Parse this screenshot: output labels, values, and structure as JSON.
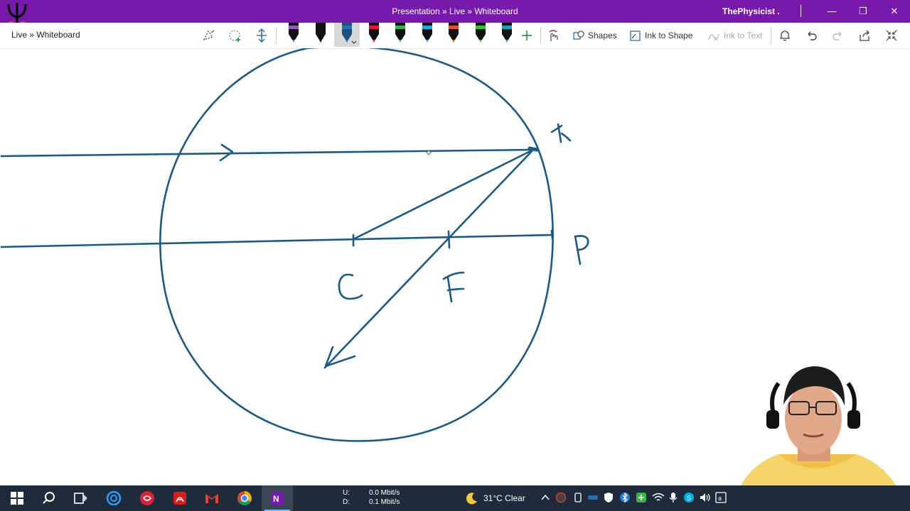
{
  "window": {
    "title": "Presentation » Live » Whiteboard",
    "user": "ThePhysicist .",
    "minimize_glyph": "—",
    "restore_glyph": "❐",
    "close_glyph": "✕"
  },
  "ribbon": {
    "breadcrumb": "Live » Whiteboard",
    "shapes_label": "Shapes",
    "ink_to_shape_label": "Ink to Shape",
    "ink_to_text_label": "Ink to Text",
    "pens": [
      {
        "icon": "black-pen-icon",
        "color": "#111111",
        "band": "#8e5bbf"
      },
      {
        "icon": "black-pen-icon",
        "color": "#111111",
        "band": "#111111"
      },
      {
        "icon": "blue-pen-icon",
        "color": "#1f4f7a",
        "band": "#2a6fb0"
      },
      {
        "icon": "red-pen-icon",
        "color": "#111111",
        "band": "#e0173a"
      },
      {
        "icon": "green-pen-icon",
        "color": "#111111",
        "band": "#38b34a"
      },
      {
        "icon": "cyan-pen-icon",
        "color": "#111111",
        "band": "#22a6e0"
      },
      {
        "icon": "orange-pen-icon",
        "color": "#111111",
        "band": "#e8502a"
      },
      {
        "icon": "green-highlighter-icon",
        "color": "#111111",
        "band": "#2ec43a"
      },
      {
        "icon": "teal-pen-icon",
        "color": "#111111",
        "band": "#1aa0b8"
      }
    ]
  },
  "whiteboard": {
    "ink_color": "#1a5a85",
    "labels": {
      "x": "X",
      "p": "P",
      "c": "C",
      "f": "F"
    }
  },
  "taskbar": {
    "upload_label": "U:",
    "download_label": "D:",
    "upload_rate": "0.0 Mbit/s",
    "download_rate": "0.1 Mbit/s",
    "weather": "31°C  Clear"
  }
}
